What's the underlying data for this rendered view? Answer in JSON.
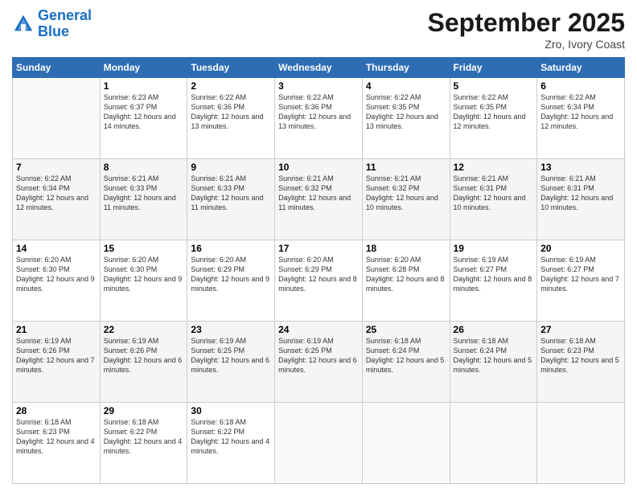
{
  "header": {
    "logo_line1": "General",
    "logo_line2": "Blue",
    "month": "September 2025",
    "location": "Zro, Ivory Coast"
  },
  "weekdays": [
    "Sunday",
    "Monday",
    "Tuesday",
    "Wednesday",
    "Thursday",
    "Friday",
    "Saturday"
  ],
  "weeks": [
    [
      {
        "day": "",
        "sunrise": "",
        "sunset": "",
        "daylight": ""
      },
      {
        "day": "1",
        "sunrise": "Sunrise: 6:23 AM",
        "sunset": "Sunset: 6:37 PM",
        "daylight": "Daylight: 12 hours and 14 minutes."
      },
      {
        "day": "2",
        "sunrise": "Sunrise: 6:22 AM",
        "sunset": "Sunset: 6:36 PM",
        "daylight": "Daylight: 12 hours and 13 minutes."
      },
      {
        "day": "3",
        "sunrise": "Sunrise: 6:22 AM",
        "sunset": "Sunset: 6:36 PM",
        "daylight": "Daylight: 12 hours and 13 minutes."
      },
      {
        "day": "4",
        "sunrise": "Sunrise: 6:22 AM",
        "sunset": "Sunset: 6:35 PM",
        "daylight": "Daylight: 12 hours and 13 minutes."
      },
      {
        "day": "5",
        "sunrise": "Sunrise: 6:22 AM",
        "sunset": "Sunset: 6:35 PM",
        "daylight": "Daylight: 12 hours and 12 minutes."
      },
      {
        "day": "6",
        "sunrise": "Sunrise: 6:22 AM",
        "sunset": "Sunset: 6:34 PM",
        "daylight": "Daylight: 12 hours and 12 minutes."
      }
    ],
    [
      {
        "day": "7",
        "sunrise": "Sunrise: 6:22 AM",
        "sunset": "Sunset: 6:34 PM",
        "daylight": "Daylight: 12 hours and 12 minutes."
      },
      {
        "day": "8",
        "sunrise": "Sunrise: 6:21 AM",
        "sunset": "Sunset: 6:33 PM",
        "daylight": "Daylight: 12 hours and 11 minutes."
      },
      {
        "day": "9",
        "sunrise": "Sunrise: 6:21 AM",
        "sunset": "Sunset: 6:33 PM",
        "daylight": "Daylight: 12 hours and 11 minutes."
      },
      {
        "day": "10",
        "sunrise": "Sunrise: 6:21 AM",
        "sunset": "Sunset: 6:32 PM",
        "daylight": "Daylight: 12 hours and 11 minutes."
      },
      {
        "day": "11",
        "sunrise": "Sunrise: 6:21 AM",
        "sunset": "Sunset: 6:32 PM",
        "daylight": "Daylight: 12 hours and 10 minutes."
      },
      {
        "day": "12",
        "sunrise": "Sunrise: 6:21 AM",
        "sunset": "Sunset: 6:31 PM",
        "daylight": "Daylight: 12 hours and 10 minutes."
      },
      {
        "day": "13",
        "sunrise": "Sunrise: 6:21 AM",
        "sunset": "Sunset: 6:31 PM",
        "daylight": "Daylight: 12 hours and 10 minutes."
      }
    ],
    [
      {
        "day": "14",
        "sunrise": "Sunrise: 6:20 AM",
        "sunset": "Sunset: 6:30 PM",
        "daylight": "Daylight: 12 hours and 9 minutes."
      },
      {
        "day": "15",
        "sunrise": "Sunrise: 6:20 AM",
        "sunset": "Sunset: 6:30 PM",
        "daylight": "Daylight: 12 hours and 9 minutes."
      },
      {
        "day": "16",
        "sunrise": "Sunrise: 6:20 AM",
        "sunset": "Sunset: 6:29 PM",
        "daylight": "Daylight: 12 hours and 9 minutes."
      },
      {
        "day": "17",
        "sunrise": "Sunrise: 6:20 AM",
        "sunset": "Sunset: 6:29 PM",
        "daylight": "Daylight: 12 hours and 8 minutes."
      },
      {
        "day": "18",
        "sunrise": "Sunrise: 6:20 AM",
        "sunset": "Sunset: 6:28 PM",
        "daylight": "Daylight: 12 hours and 8 minutes."
      },
      {
        "day": "19",
        "sunrise": "Sunrise: 6:19 AM",
        "sunset": "Sunset: 6:27 PM",
        "daylight": "Daylight: 12 hours and 8 minutes."
      },
      {
        "day": "20",
        "sunrise": "Sunrise: 6:19 AM",
        "sunset": "Sunset: 6:27 PM",
        "daylight": "Daylight: 12 hours and 7 minutes."
      }
    ],
    [
      {
        "day": "21",
        "sunrise": "Sunrise: 6:19 AM",
        "sunset": "Sunset: 6:26 PM",
        "daylight": "Daylight: 12 hours and 7 minutes."
      },
      {
        "day": "22",
        "sunrise": "Sunrise: 6:19 AM",
        "sunset": "Sunset: 6:26 PM",
        "daylight": "Daylight: 12 hours and 6 minutes."
      },
      {
        "day": "23",
        "sunrise": "Sunrise: 6:19 AM",
        "sunset": "Sunset: 6:25 PM",
        "daylight": "Daylight: 12 hours and 6 minutes."
      },
      {
        "day": "24",
        "sunrise": "Sunrise: 6:19 AM",
        "sunset": "Sunset: 6:25 PM",
        "daylight": "Daylight: 12 hours and 6 minutes."
      },
      {
        "day": "25",
        "sunrise": "Sunrise: 6:18 AM",
        "sunset": "Sunset: 6:24 PM",
        "daylight": "Daylight: 12 hours and 5 minutes."
      },
      {
        "day": "26",
        "sunrise": "Sunrise: 6:18 AM",
        "sunset": "Sunset: 6:24 PM",
        "daylight": "Daylight: 12 hours and 5 minutes."
      },
      {
        "day": "27",
        "sunrise": "Sunrise: 6:18 AM",
        "sunset": "Sunset: 6:23 PM",
        "daylight": "Daylight: 12 hours and 5 minutes."
      }
    ],
    [
      {
        "day": "28",
        "sunrise": "Sunrise: 6:18 AM",
        "sunset": "Sunset: 6:23 PM",
        "daylight": "Daylight: 12 hours and 4 minutes."
      },
      {
        "day": "29",
        "sunrise": "Sunrise: 6:18 AM",
        "sunset": "Sunset: 6:22 PM",
        "daylight": "Daylight: 12 hours and 4 minutes."
      },
      {
        "day": "30",
        "sunrise": "Sunrise: 6:18 AM",
        "sunset": "Sunset: 6:22 PM",
        "daylight": "Daylight: 12 hours and 4 minutes."
      },
      {
        "day": "",
        "sunrise": "",
        "sunset": "",
        "daylight": ""
      },
      {
        "day": "",
        "sunrise": "",
        "sunset": "",
        "daylight": ""
      },
      {
        "day": "",
        "sunrise": "",
        "sunset": "",
        "daylight": ""
      },
      {
        "day": "",
        "sunrise": "",
        "sunset": "",
        "daylight": ""
      }
    ]
  ]
}
